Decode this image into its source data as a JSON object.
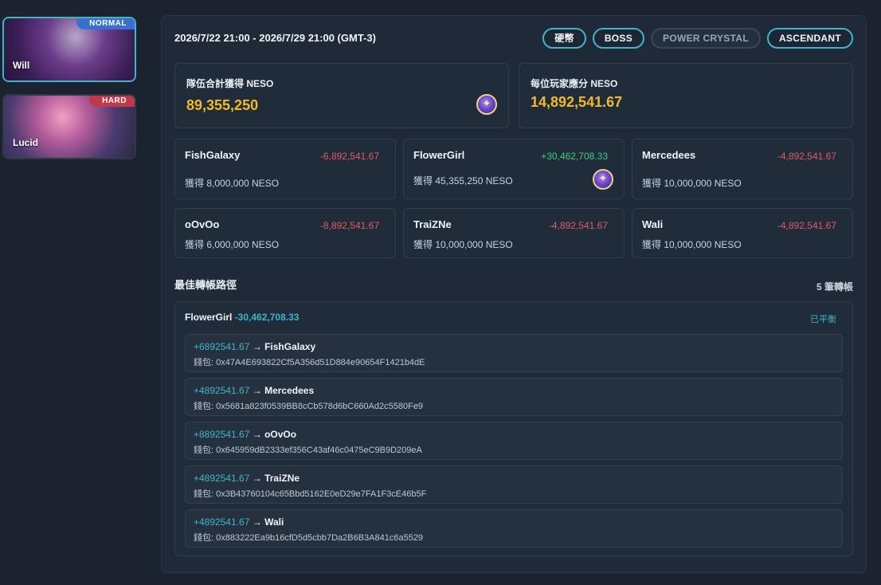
{
  "sidebar": {
    "bosses": [
      {
        "name": "Will",
        "difficulty": "NORMAL",
        "diff_color": "#3a6fd0",
        "selected": true
      },
      {
        "name": "Lucid",
        "difficulty": "HARD",
        "diff_color": "#c0394a",
        "selected": false
      }
    ]
  },
  "header": {
    "date_range": "2026/7/22 21:00 - 2026/7/29 21:00 (GMT-3)",
    "filters": [
      "硬幣",
      "BOSS",
      "POWER CRYSTAL",
      "ASCENDANT"
    ]
  },
  "summary": {
    "team_total_label": "隊伍合計獲得 NESO",
    "team_total_value": "89,355,250",
    "per_player_label": "每位玩家應分 NESO",
    "per_player_value": "14,892,541.67"
  },
  "players": [
    {
      "name": "FishGalaxy",
      "delta": "-6,892,541.67",
      "got": "獲得 8,000,000 NESO"
    },
    {
      "name": "FlowerGirl",
      "delta": "+30,462,708.33",
      "got": "獲得 45,355,250 NESO"
    },
    {
      "name": "Mercedees",
      "delta": "-4,892,541.67",
      "got": "獲得 10,000,000 NESO"
    },
    {
      "name": "oOvOo",
      "delta": "-8,892,541.67",
      "got": "獲得 6,000,000 NESO"
    },
    {
      "name": "TraiZNe",
      "delta": "-4,892,541.67",
      "got": "獲得 10,000,000 NESO"
    },
    {
      "name": "Wali",
      "delta": "-4,892,541.67",
      "got": "獲得 10,000,000 NESO"
    }
  ],
  "routes": {
    "title": "最佳轉帳路徑",
    "count": "5 筆轉帳",
    "payer": "FlowerGirl",
    "payer_amount": "-30,462,708.33",
    "status": "已平衡",
    "arrow": "→",
    "transfers": [
      {
        "amount": "+6892541.67",
        "to": "FishGalaxy",
        "wallet": "錢包: 0x47A4E693822Cf5A356d51D884e90654F1421b4dE"
      },
      {
        "amount": "+4892541.67",
        "to": "Mercedees",
        "wallet": "錢包: 0x5681a823f0539BB8cCb578d6bC660Ad2c5580Fe9"
      },
      {
        "amount": "+8892541.67",
        "to": "oOvOo",
        "wallet": "錢包: 0x645959dB2333ef356C43af46c0475eC9B9D209eA"
      },
      {
        "amount": "+4892541.67",
        "to": "TraiZNe",
        "wallet": "錢包: 0x3B43760104c65Bbd5162E0eD29e7FA1F3cE46b5F"
      },
      {
        "amount": "+4892541.67",
        "to": "Wali",
        "wallet": "錢包: 0x883222Ea9b16cfD5d5cbb7Da2B6B3A841c6a5529"
      }
    ]
  }
}
